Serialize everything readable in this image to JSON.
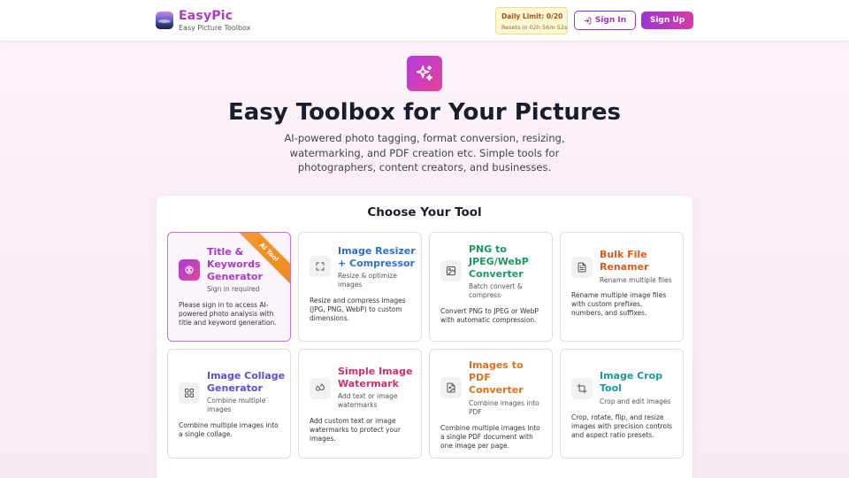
{
  "header": {
    "brand_name": "EasyPic",
    "brand_tagline": "Easy Picture Toolbox",
    "limit_title": "Daily Limit: 0/20",
    "limit_reset": "Resets in 02h 56m 52s",
    "signin_label": "Sign In",
    "signup_label": "Sign Up"
  },
  "hero": {
    "title": "Easy Toolbox for Your Pictures",
    "description": "AI-powered photo tagging, format conversion, resizing, watermarking, and PDF creation etc. Simple tools for photographers, content creators, and businesses."
  },
  "tools_section": {
    "title": "Choose Your Tool",
    "tools": [
      {
        "title": "Title & Keywords Generator",
        "subtitle": "Sign in required",
        "description": "Please sign in to access AI-powered photo analysis with title and keyword generation.",
        "badge": "AI Tool",
        "color": "#a63ac9",
        "icon": "brain-icon"
      },
      {
        "title": "Image Resizer + Compressor",
        "subtitle": "Resize & optimize images",
        "description": "Resize and compress images (JPG, PNG, WebP) to custom dimensions.",
        "color": "#2a6fd6",
        "icon": "expand-icon"
      },
      {
        "title": "PNG to JPEG/WebP Converter",
        "subtitle": "Batch convert & compress",
        "description": "Convert PNG to JPEG or WebP with automatic compression.",
        "color": "#179a5e",
        "icon": "image-icon"
      },
      {
        "title": "Bulk File Renamer",
        "subtitle": "Rename multiple files",
        "description": "Rename multiple image files with custom prefixes, numbers, and suffixes.",
        "color": "#e05a1a",
        "icon": "file-text-icon"
      },
      {
        "title": "Image Collage Generator",
        "subtitle": "Combine multiple images",
        "description": "Combine multiple images into a single collage.",
        "color": "#5a4fd6",
        "icon": "grid-icon"
      },
      {
        "title": "Simple Image Watermark",
        "subtitle": "Add text or image watermarks",
        "description": "Add custom text or image watermarks to protect your images.",
        "color": "#d42a6e",
        "icon": "droplet-icon"
      },
      {
        "title": "Images to PDF Converter",
        "subtitle": "Combine images into PDF",
        "description": "Combine multiple images into a single PDF document with one image per page.",
        "color": "#e0701a",
        "icon": "file-image-icon"
      },
      {
        "title": "Image Crop Tool",
        "subtitle": "Crop and edit images",
        "description": "Crop, rotate, flip, and resize images with precision controls and aspect ratio presets.",
        "color": "#1a9a9a",
        "icon": "crop-icon"
      }
    ]
  }
}
